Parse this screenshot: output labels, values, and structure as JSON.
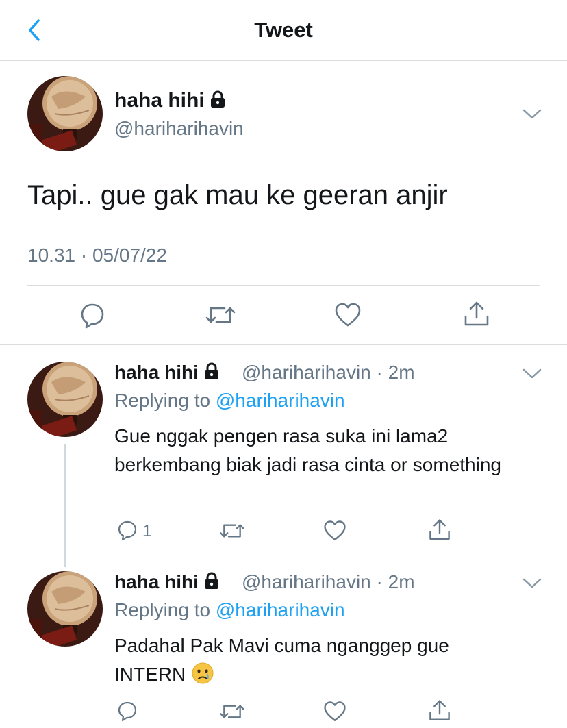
{
  "header": {
    "title": "Tweet",
    "back_icon": "chevron-left-icon",
    "accent": "#1da1f2"
  },
  "main_tweet": {
    "display_name": "haha hihi",
    "handle": "@hariharihavin",
    "text": "Tapi.. gue gak mau ke geeran anjir",
    "timestamp": "10.31 · 05/07/22",
    "protected_icon": "lock-icon",
    "actions": [
      "reply-icon",
      "retweet-icon",
      "like-icon",
      "share-icon"
    ]
  },
  "replies": [
    {
      "display_name": "haha hihi",
      "handle": "@hariharihavin",
      "separator": "·",
      "time": "2m",
      "replying_prefix": "Replying to",
      "replying_to": "@hariharihavin",
      "text": "Gue nggak pengen rasa suka ini lama2 berkembang biak jadi rasa cinta or something",
      "reply_count": "1"
    },
    {
      "display_name": "haha hihi",
      "handle": "@hariharihavin",
      "separator": "·",
      "time": "2m",
      "replying_prefix": "Replying to",
      "replying_to": "@hariharihavin",
      "text": "Padahal Pak Mavi cuma nganggep gue INTERN",
      "emoji": "crying-face-emoji"
    }
  ]
}
